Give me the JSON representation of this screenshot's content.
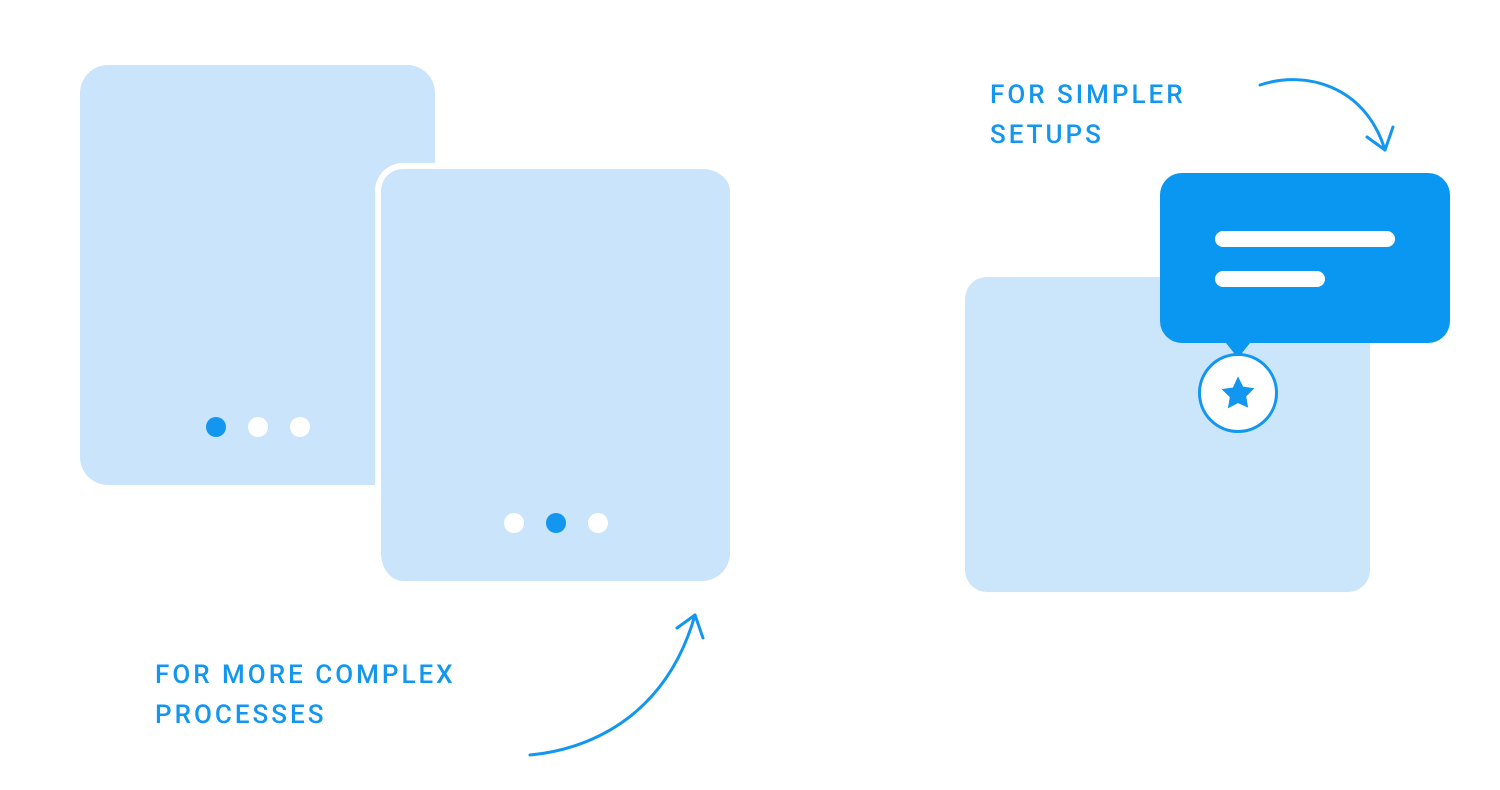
{
  "captions": {
    "complex": "FOR MORE COMPLEX PROCESSES",
    "simple": "FOR SIMPLER SETUPS"
  },
  "colors": {
    "accent": "#1296f0",
    "panel": "#cbe5fb",
    "tooltip": "#0a97f1",
    "white": "#ffffff"
  },
  "left_cards": {
    "back_active_index": 0,
    "front_active_index": 1,
    "dot_count": 3
  }
}
